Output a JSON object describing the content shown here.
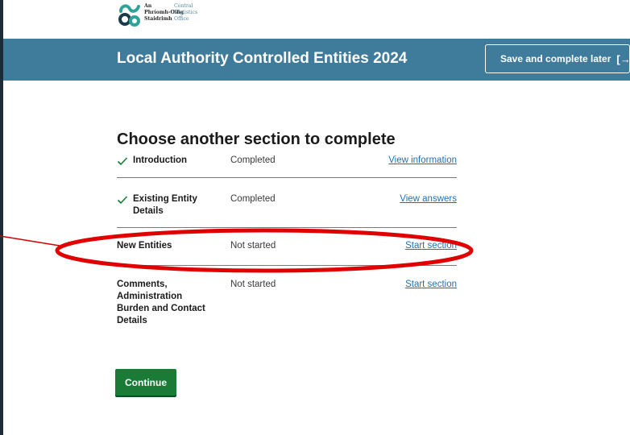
{
  "logo": {
    "irish_lines": [
      "An",
      "Phríomh-Oifig",
      "Staidrimh"
    ],
    "english_lines": [
      "Central",
      "Statistics",
      "Office"
    ]
  },
  "header": {
    "title": "Local Authority Controlled Entities 2024",
    "save_label": "Save and complete later",
    "save_icon": "exit-icon"
  },
  "main": {
    "heading": "Choose another section to complete",
    "sections": [
      {
        "name": "Introduction",
        "status": "Completed",
        "action": "View information",
        "completed": true
      },
      {
        "name": "Existing Entity Details",
        "status": "Completed",
        "action": "View answers",
        "completed": true
      },
      {
        "name": "New Entities",
        "status": "Not started",
        "action": "Start section",
        "completed": false,
        "highlighted": true
      },
      {
        "name": "Comments, Administration Burden and Contact Details",
        "status": "Not started",
        "action": "Start section",
        "completed": false
      }
    ],
    "continue_label": "Continue"
  },
  "colors": {
    "header": "#3f7b9a",
    "continue": "#1a7b37",
    "link": "#1d70b8",
    "check": "#1a7b37",
    "annotation": "#e00000"
  }
}
